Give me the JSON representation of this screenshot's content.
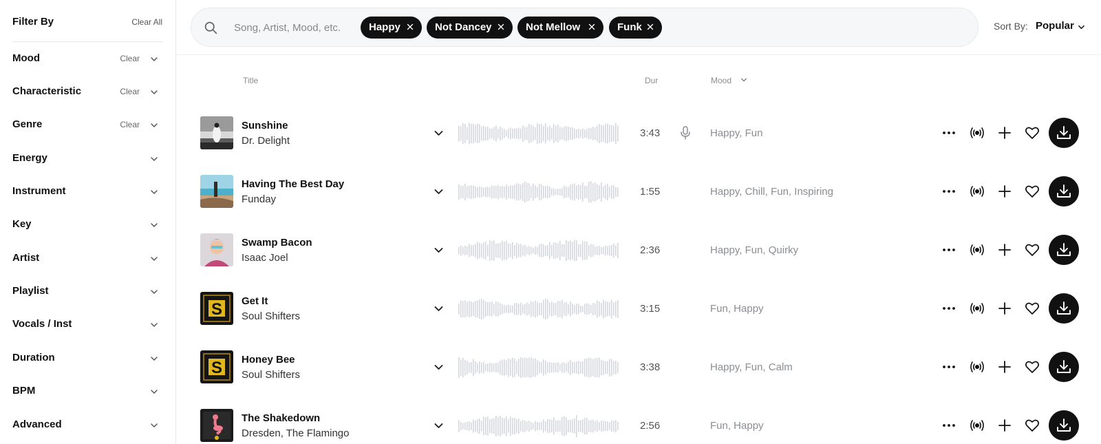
{
  "sidebar": {
    "title": "Filter By",
    "clear_all": "Clear All",
    "filters": [
      {
        "label": "Mood",
        "clear": "Clear"
      },
      {
        "label": "Characteristic",
        "clear": "Clear"
      },
      {
        "label": "Genre",
        "clear": "Clear"
      },
      {
        "label": "Energy",
        "clear": ""
      },
      {
        "label": "Instrument",
        "clear": ""
      },
      {
        "label": "Key",
        "clear": ""
      },
      {
        "label": "Artist",
        "clear": ""
      },
      {
        "label": "Playlist",
        "clear": ""
      },
      {
        "label": "Vocals / Inst",
        "clear": ""
      },
      {
        "label": "Duration",
        "clear": ""
      },
      {
        "label": "BPM",
        "clear": ""
      },
      {
        "label": "Advanced",
        "clear": ""
      }
    ]
  },
  "search": {
    "placeholder": "Song, Artist, Mood, etc.",
    "chips": [
      "Happy",
      "Not Dancey",
      "Not Mellow",
      "Funk"
    ]
  },
  "sort": {
    "label": "Sort By:",
    "value": "Popular"
  },
  "columns": {
    "title": "Title",
    "duration": "Dur",
    "mood": "Mood"
  },
  "tracks": [
    {
      "title": "Sunshine",
      "artist": "Dr. Delight",
      "duration": "3:43",
      "moods": "Happy, Fun",
      "vocals": true,
      "cover": "bw-figure"
    },
    {
      "title": "Having The Best Day",
      "artist": "Funday",
      "duration": "1:55",
      "moods": "Happy, Chill, Fun, Inspiring",
      "vocals": false,
      "cover": "beach"
    },
    {
      "title": "Swamp Bacon",
      "artist": "Isaac Joel",
      "duration": "2:36",
      "moods": "Happy, Fun, Quirky",
      "vocals": false,
      "cover": "portrait"
    },
    {
      "title": "Get It",
      "artist": "Soul Shifters",
      "duration": "3:15",
      "moods": "Fun, Happy",
      "vocals": false,
      "cover": "s-logo"
    },
    {
      "title": "Honey Bee",
      "artist": "Soul Shifters",
      "duration": "3:38",
      "moods": "Happy, Fun, Calm",
      "vocals": false,
      "cover": "s-logo"
    },
    {
      "title": "The Shakedown",
      "artist": "Dresden, The Flamingo",
      "duration": "2:56",
      "moods": "Fun, Happy",
      "vocals": false,
      "cover": "flamingo"
    }
  ],
  "icons": {
    "search": "search-icon",
    "chip_remove": "close-icon",
    "chevron": "chevron-down-icon",
    "vocals": "microphone-icon",
    "more": "more-dots-icon",
    "stems": "broadcast-icon",
    "add": "plus-icon",
    "favorite": "heart-icon",
    "download": "download-icon"
  },
  "colors": {
    "accent": "#111111",
    "muted_text": "#8a8d93",
    "waveform": "#d4d7de",
    "border": "#e6e7ea"
  }
}
